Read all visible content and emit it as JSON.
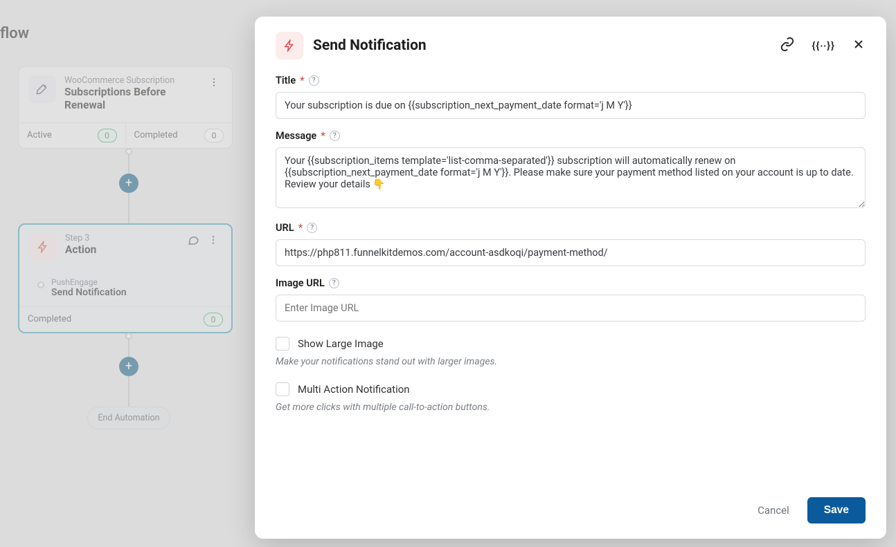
{
  "page": {
    "heading": "flow"
  },
  "flow": {
    "trigger": {
      "overline": "WooCommerce Subscription",
      "title": "Subscriptions Before Renewal",
      "status": {
        "active_label": "Active",
        "active_count": "0",
        "completed_label": "Completed",
        "completed_count": "0"
      }
    },
    "action": {
      "step_label": "Step 3",
      "title": "Action",
      "provider": "PushEngage",
      "action_name": "Send Notification",
      "status": {
        "completed_label": "Completed",
        "completed_count": "0"
      }
    },
    "end_label": "End Automation"
  },
  "panel": {
    "title": "Send Notification",
    "fields": {
      "title": {
        "label": "Title",
        "value": "Your subscription is due on {{subscription_next_payment_date format='j M Y'}}"
      },
      "message": {
        "label": "Message",
        "value": "Your {{subscription_items template='list-comma-separated'}} subscription will automatically renew on {{subscription_next_payment_date format='j M Y'}}. Please make sure your payment method listed on your account is up to date. Review your details 👇"
      },
      "url": {
        "label": "URL",
        "value": "https://php811.funnelkitdemos.com/account-asdkoqi/payment-method/"
      },
      "image_url": {
        "label": "Image URL",
        "placeholder": "Enter Image URL"
      },
      "large_image": {
        "label": "Show Large Image",
        "hint": "Make your notifications stand out with larger images."
      },
      "multi_action": {
        "label": "Multi Action Notification",
        "hint": "Get more clicks with multiple call-to-action buttons."
      }
    },
    "buttons": {
      "cancel": "Cancel",
      "save": "Save"
    }
  }
}
